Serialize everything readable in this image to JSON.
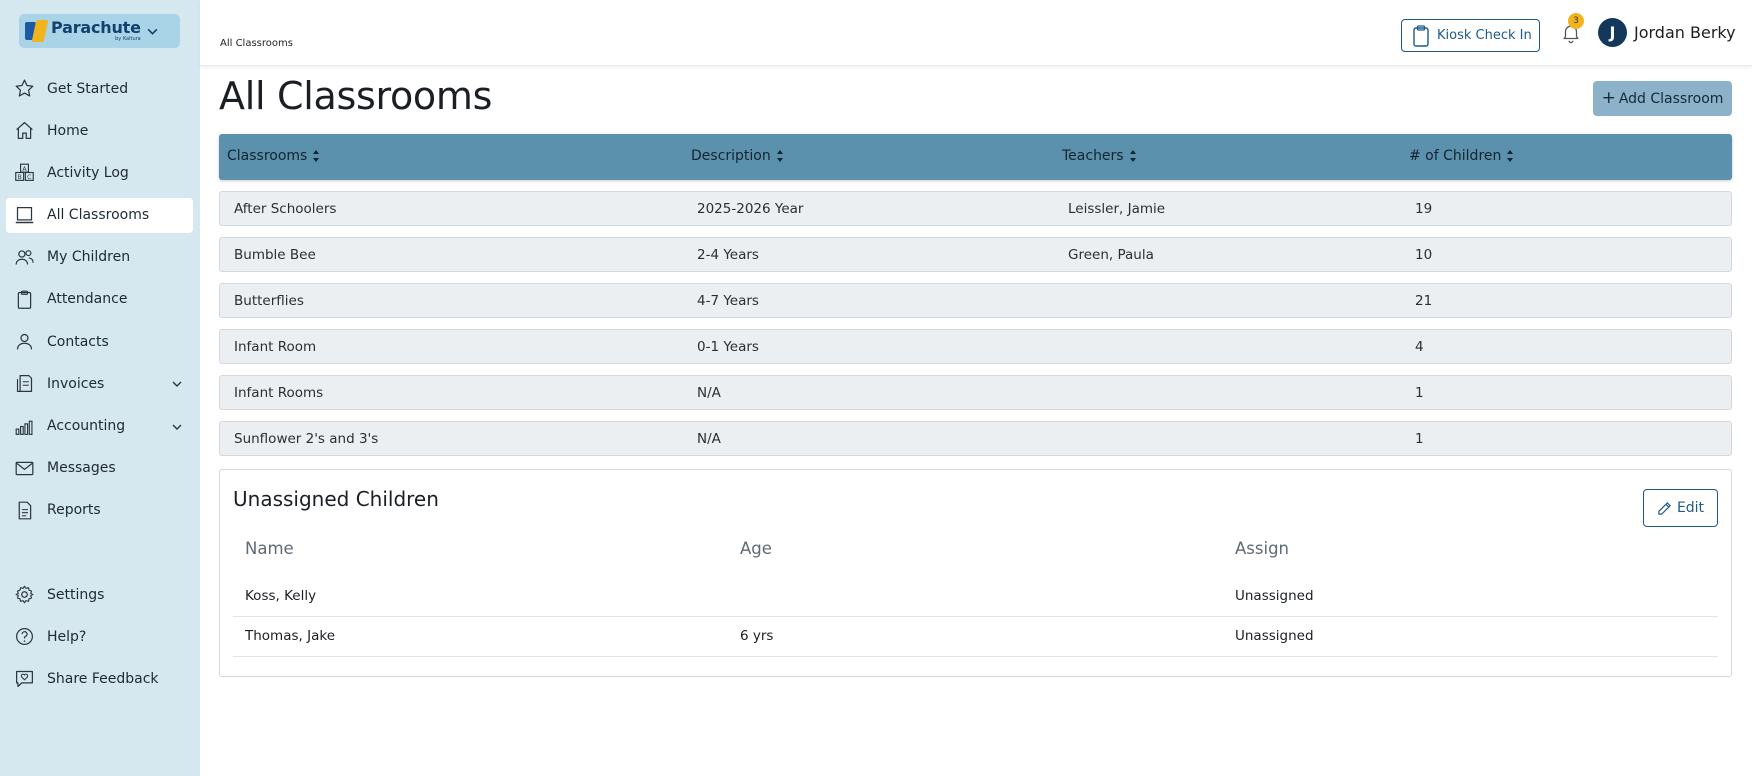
{
  "brand": {
    "name": "Parachute",
    "sub": "by Kaltura"
  },
  "sidebar": {
    "items": [
      {
        "label": "Get Started",
        "icon": "star-icon"
      },
      {
        "label": "Home",
        "icon": "home-icon"
      },
      {
        "label": "Activity Log",
        "icon": "abc-blocks-icon"
      },
      {
        "label": "All Classrooms",
        "icon": "laptop-icon"
      },
      {
        "label": "My Children",
        "icon": "users-icon"
      },
      {
        "label": "Attendance",
        "icon": "clipboard-icon"
      },
      {
        "label": "Contacts",
        "icon": "person-icon"
      },
      {
        "label": "Invoices",
        "icon": "invoice-icon"
      },
      {
        "label": "Accounting",
        "icon": "bar-chart-icon"
      },
      {
        "label": "Messages",
        "icon": "envelope-icon"
      },
      {
        "label": "Reports",
        "icon": "document-icon"
      }
    ],
    "bottom_items": [
      {
        "label": "Settings",
        "icon": "gear-icon"
      },
      {
        "label": "Help?",
        "icon": "help-icon"
      },
      {
        "label": "Share Feedback",
        "icon": "feedback-icon"
      }
    ]
  },
  "header": {
    "breadcrumb": "All Classrooms",
    "kiosk_label": "Kiosk Check In",
    "notification_count": "3",
    "avatar_initial": "J",
    "user_name": "Jordan Berky"
  },
  "main": {
    "title": "All Classrooms",
    "add_button": "Add Classroom",
    "add_button_icon": "+",
    "columns": [
      "Classrooms",
      "Description",
      "Teachers",
      "# of Children"
    ],
    "rows": [
      [
        "After Schoolers",
        "2025-2026 Year",
        "Leissler, Jamie",
        "19"
      ],
      [
        "Bumble Bee",
        "2-4 Years",
        "Green, Paula",
        "10"
      ],
      [
        "Butterflies",
        "4-7 Years",
        "",
        "21"
      ],
      [
        "Infant Room",
        "0-1 Years",
        "",
        "4"
      ],
      [
        "Infant Rooms",
        "N/A",
        "",
        "1"
      ],
      [
        "Sunflower 2's and 3's",
        "N/A",
        "",
        "1"
      ]
    ]
  },
  "unassigned": {
    "title": "Unassigned Children",
    "edit_label": "Edit",
    "columns": [
      "Name",
      "Age",
      "Assign"
    ],
    "rows": [
      [
        "Koss, Kelly",
        "",
        "Unassigned"
      ],
      [
        "Thomas, Jake",
        "6 yrs",
        "Unassigned"
      ]
    ]
  },
  "colors": {
    "sidebar_bg": "#d6e8ef",
    "table_header_bg": "#5b91ad",
    "primary_button_bg": "#8bb2c9",
    "accent": "#1d5a8a",
    "badge": "#f2b41c"
  }
}
